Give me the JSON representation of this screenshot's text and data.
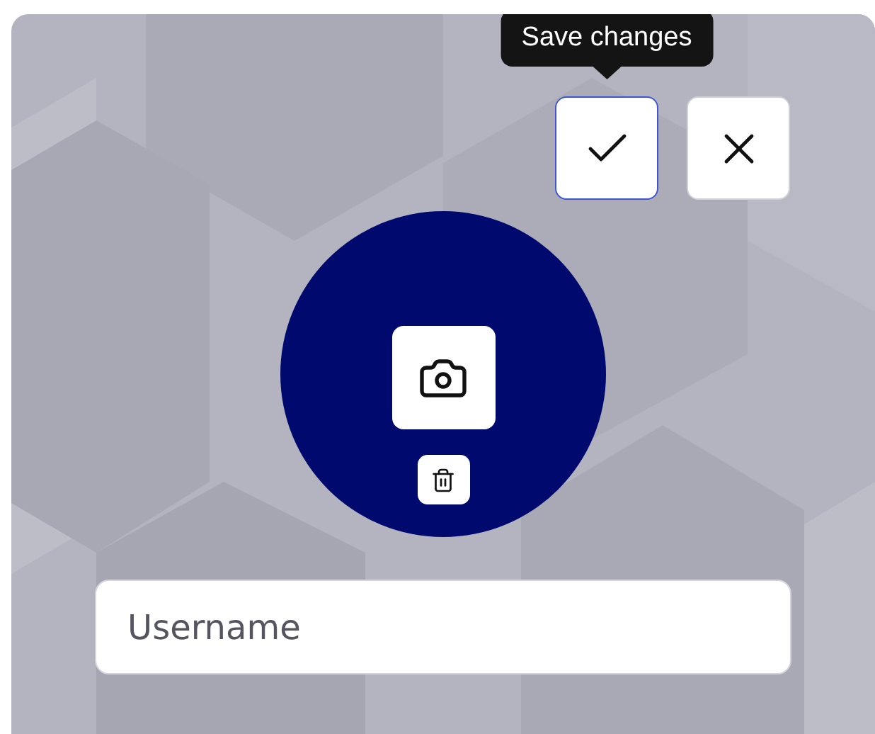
{
  "tooltip": {
    "text": "Save changes"
  },
  "actions": [
    {
      "kind": "save",
      "focused": true
    },
    {
      "kind": "cancel",
      "focused": false
    }
  ],
  "avatar": {
    "actions": [
      {
        "kind": "camera"
      },
      {
        "kind": "delete"
      }
    ]
  },
  "username": {
    "placeholder": "Username"
  }
}
